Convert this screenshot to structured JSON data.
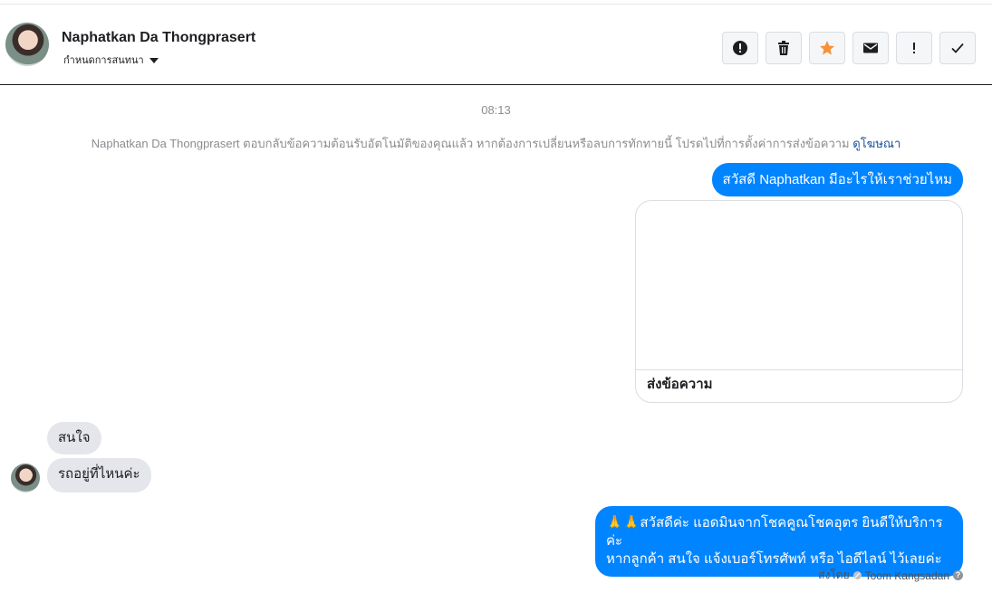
{
  "header": {
    "name": "Naphatkan Da Thongprasert",
    "subtitle": "กำหนดการสนทนา",
    "actions": [
      "alert-icon",
      "trash-icon",
      "star-icon",
      "envelope-icon",
      "exclamation-icon",
      "check-icon"
    ]
  },
  "thread": {
    "time": "08:13",
    "notice_text": "Naphatkan Da Thongprasert ตอบกลับข้อความต้อนรับอัตโนมัติของคุณแล้ว หากต้องการเปลี่ยนหรือลบการทักทายนี้ โปรดไปที่การตั้งค่าการส่งข้อความ",
    "notice_link": "ดูโฆษณา",
    "greeting": "สวัสดี Naphatkan มีอะไรให้เราช่วยไหม",
    "card_button": "ส่งข้อความ",
    "incoming": [
      "สนใจ",
      "รถอยู่ที่ไหนค่ะ"
    ],
    "reply_emoji": "🙏🙏",
    "reply_line1": "สวัสดีค่ะ แอดมินจากโชคคูณโชคอุตร ยินดีให้บริการค่ะ",
    "reply_line2": "หากลูกค้า สนใจ แจ้งเบอร์โทรศัพท์ หรือ ไอดีไลน์  ไว้เลยค่ะ",
    "sent_by_label": "ส่งโดย",
    "sent_by_name": "Toom Kangsadan"
  },
  "colors": {
    "outgoing": "#0084ff",
    "incoming": "#e4e6eb",
    "star": "#f7923a"
  }
}
